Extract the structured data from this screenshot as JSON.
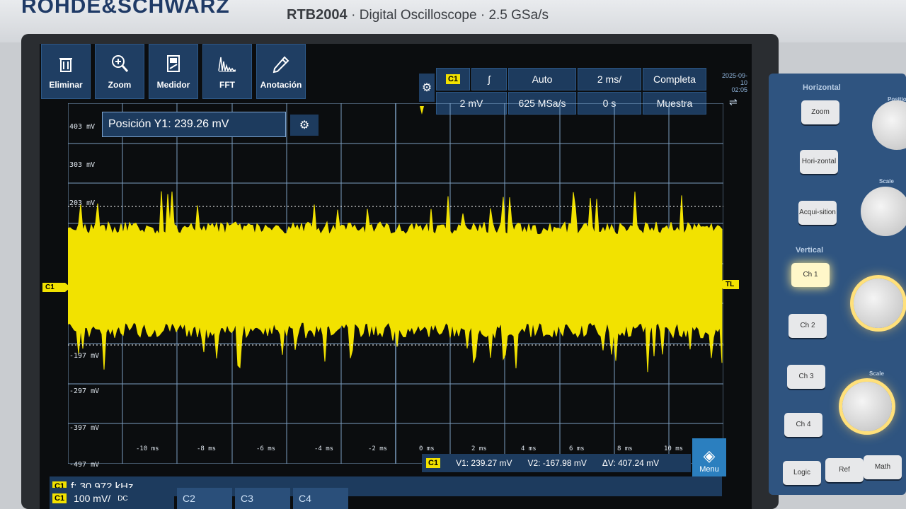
{
  "device": {
    "brand": "ROHDE&SCHWARZ",
    "model": "RTB2004",
    "subtitle": "· Digital Oscilloscope · 2.5 GSa/s"
  },
  "toolbar": [
    {
      "label": "Eliminar",
      "icon": "trash-icon"
    },
    {
      "label": "Zoom",
      "icon": "zoom-icon"
    },
    {
      "label": "Medidor",
      "icon": "meter-icon"
    },
    {
      "label": "FFT",
      "icon": "fft-icon"
    },
    {
      "label": "Anotación",
      "icon": "pencil-icon"
    }
  ],
  "trigger": {
    "source": "C1",
    "slope_icon": "rising-edge-icon",
    "level": "2 mV",
    "mode": "Auto",
    "sample_rate": "625 MSa/s",
    "time_scale": "2 ms/",
    "time_offset": "0 s",
    "acquisition": "Completa",
    "acq_mode": "Muestra",
    "date": "2025-09-10",
    "time": "02:05"
  },
  "popup": {
    "label": "Posición Y1: 239.26 mV"
  },
  "vertical_labels": [
    "403 mV",
    "303 mV",
    "203 mV",
    "-197 mV",
    "-297 mV",
    "-397 mV",
    "-497 mV"
  ],
  "time_labels": [
    "-10 ms",
    "-8 ms",
    "-6 ms",
    "-4 ms",
    "-2 ms",
    "0 ms",
    "2 ms",
    "4 ms",
    "6 ms",
    "8 ms",
    "10 ms"
  ],
  "markers": {
    "c1": "C1",
    "tl": "TL"
  },
  "measurement": {
    "channel": "C1",
    "v1": "V1: 239.27 mV",
    "v2": "V2: -167.98 mV",
    "dv": "ΔV: 407.24 mV"
  },
  "menu": {
    "label": "Menu"
  },
  "frequency": {
    "channel": "C1",
    "text": "f: 30.972 kHz"
  },
  "channels": {
    "c1_label": "C1",
    "c1_scale": "100 mV/",
    "c1_coupling": "DC",
    "tabs": [
      "C2",
      "C3",
      "C4"
    ]
  },
  "panel": {
    "horizontal_title": "Horizontal",
    "vertical_title": "Vertical",
    "buttons_h": [
      "Zoom",
      "Hori-zontal",
      "Acqui-sition"
    ],
    "buttons_v": [
      "Ch 1",
      "Ch 2",
      "Ch 3",
      "Ch 4"
    ],
    "bottom_buttons": [
      "Logic",
      "Ref",
      "Math"
    ],
    "position_label": "Position",
    "scale_label": "Scale"
  },
  "colors": {
    "trace": "#f2e200",
    "ui_blue": "#1d3b5e",
    "accent": "#2b7fbf"
  }
}
